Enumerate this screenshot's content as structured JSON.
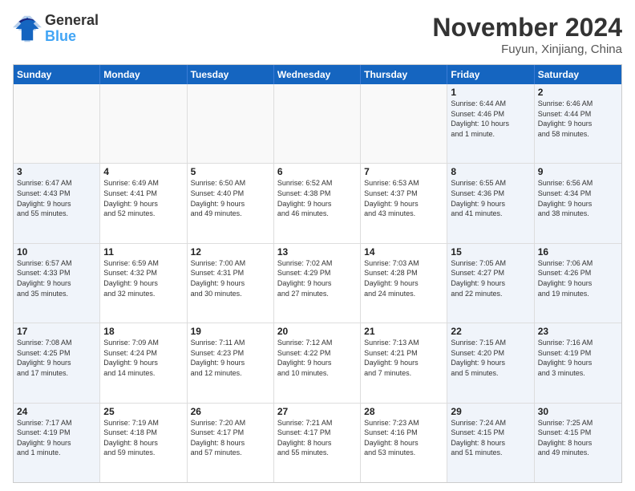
{
  "logo": {
    "line1": "General",
    "line2": "Blue"
  },
  "title": "November 2024",
  "location": "Fuyun, Xinjiang, China",
  "weekdays": [
    "Sunday",
    "Monday",
    "Tuesday",
    "Wednesday",
    "Thursday",
    "Friday",
    "Saturday"
  ],
  "rows": [
    [
      {
        "day": "",
        "info": "",
        "type": "empty"
      },
      {
        "day": "",
        "info": "",
        "type": "empty"
      },
      {
        "day": "",
        "info": "",
        "type": "empty"
      },
      {
        "day": "",
        "info": "",
        "type": "empty"
      },
      {
        "day": "",
        "info": "",
        "type": "empty"
      },
      {
        "day": "1",
        "info": "Sunrise: 6:44 AM\nSunset: 4:46 PM\nDaylight: 10 hours\nand 1 minute.",
        "type": "friday"
      },
      {
        "day": "2",
        "info": "Sunrise: 6:46 AM\nSunset: 4:44 PM\nDaylight: 9 hours\nand 58 minutes.",
        "type": "saturday"
      }
    ],
    [
      {
        "day": "3",
        "info": "Sunrise: 6:47 AM\nSunset: 4:43 PM\nDaylight: 9 hours\nand 55 minutes.",
        "type": "sunday"
      },
      {
        "day": "4",
        "info": "Sunrise: 6:49 AM\nSunset: 4:41 PM\nDaylight: 9 hours\nand 52 minutes.",
        "type": "weekday"
      },
      {
        "day": "5",
        "info": "Sunrise: 6:50 AM\nSunset: 4:40 PM\nDaylight: 9 hours\nand 49 minutes.",
        "type": "weekday"
      },
      {
        "day": "6",
        "info": "Sunrise: 6:52 AM\nSunset: 4:38 PM\nDaylight: 9 hours\nand 46 minutes.",
        "type": "weekday"
      },
      {
        "day": "7",
        "info": "Sunrise: 6:53 AM\nSunset: 4:37 PM\nDaylight: 9 hours\nand 43 minutes.",
        "type": "weekday"
      },
      {
        "day": "8",
        "info": "Sunrise: 6:55 AM\nSunset: 4:36 PM\nDaylight: 9 hours\nand 41 minutes.",
        "type": "friday"
      },
      {
        "day": "9",
        "info": "Sunrise: 6:56 AM\nSunset: 4:34 PM\nDaylight: 9 hours\nand 38 minutes.",
        "type": "saturday"
      }
    ],
    [
      {
        "day": "10",
        "info": "Sunrise: 6:57 AM\nSunset: 4:33 PM\nDaylight: 9 hours\nand 35 minutes.",
        "type": "sunday"
      },
      {
        "day": "11",
        "info": "Sunrise: 6:59 AM\nSunset: 4:32 PM\nDaylight: 9 hours\nand 32 minutes.",
        "type": "weekday"
      },
      {
        "day": "12",
        "info": "Sunrise: 7:00 AM\nSunset: 4:31 PM\nDaylight: 9 hours\nand 30 minutes.",
        "type": "weekday"
      },
      {
        "day": "13",
        "info": "Sunrise: 7:02 AM\nSunset: 4:29 PM\nDaylight: 9 hours\nand 27 minutes.",
        "type": "weekday"
      },
      {
        "day": "14",
        "info": "Sunrise: 7:03 AM\nSunset: 4:28 PM\nDaylight: 9 hours\nand 24 minutes.",
        "type": "weekday"
      },
      {
        "day": "15",
        "info": "Sunrise: 7:05 AM\nSunset: 4:27 PM\nDaylight: 9 hours\nand 22 minutes.",
        "type": "friday"
      },
      {
        "day": "16",
        "info": "Sunrise: 7:06 AM\nSunset: 4:26 PM\nDaylight: 9 hours\nand 19 minutes.",
        "type": "saturday"
      }
    ],
    [
      {
        "day": "17",
        "info": "Sunrise: 7:08 AM\nSunset: 4:25 PM\nDaylight: 9 hours\nand 17 minutes.",
        "type": "sunday"
      },
      {
        "day": "18",
        "info": "Sunrise: 7:09 AM\nSunset: 4:24 PM\nDaylight: 9 hours\nand 14 minutes.",
        "type": "weekday"
      },
      {
        "day": "19",
        "info": "Sunrise: 7:11 AM\nSunset: 4:23 PM\nDaylight: 9 hours\nand 12 minutes.",
        "type": "weekday"
      },
      {
        "day": "20",
        "info": "Sunrise: 7:12 AM\nSunset: 4:22 PM\nDaylight: 9 hours\nand 10 minutes.",
        "type": "weekday"
      },
      {
        "day": "21",
        "info": "Sunrise: 7:13 AM\nSunset: 4:21 PM\nDaylight: 9 hours\nand 7 minutes.",
        "type": "weekday"
      },
      {
        "day": "22",
        "info": "Sunrise: 7:15 AM\nSunset: 4:20 PM\nDaylight: 9 hours\nand 5 minutes.",
        "type": "friday"
      },
      {
        "day": "23",
        "info": "Sunrise: 7:16 AM\nSunset: 4:19 PM\nDaylight: 9 hours\nand 3 minutes.",
        "type": "saturday"
      }
    ],
    [
      {
        "day": "24",
        "info": "Sunrise: 7:17 AM\nSunset: 4:19 PM\nDaylight: 9 hours\nand 1 minute.",
        "type": "sunday"
      },
      {
        "day": "25",
        "info": "Sunrise: 7:19 AM\nSunset: 4:18 PM\nDaylight: 8 hours\nand 59 minutes.",
        "type": "weekday"
      },
      {
        "day": "26",
        "info": "Sunrise: 7:20 AM\nSunset: 4:17 PM\nDaylight: 8 hours\nand 57 minutes.",
        "type": "weekday"
      },
      {
        "day": "27",
        "info": "Sunrise: 7:21 AM\nSunset: 4:17 PM\nDaylight: 8 hours\nand 55 minutes.",
        "type": "weekday"
      },
      {
        "day": "28",
        "info": "Sunrise: 7:23 AM\nSunset: 4:16 PM\nDaylight: 8 hours\nand 53 minutes.",
        "type": "weekday"
      },
      {
        "day": "29",
        "info": "Sunrise: 7:24 AM\nSunset: 4:15 PM\nDaylight: 8 hours\nand 51 minutes.",
        "type": "friday"
      },
      {
        "day": "30",
        "info": "Sunrise: 7:25 AM\nSunset: 4:15 PM\nDaylight: 8 hours\nand 49 minutes.",
        "type": "saturday"
      }
    ]
  ]
}
